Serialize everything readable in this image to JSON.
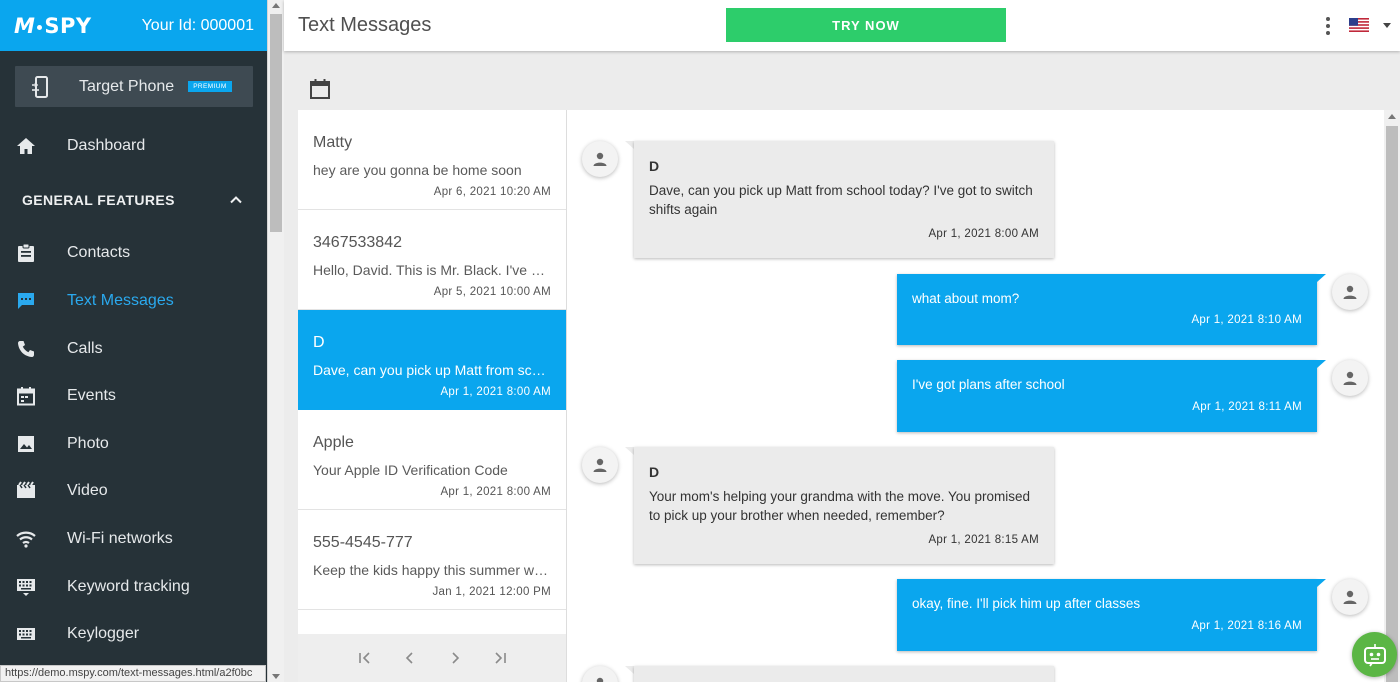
{
  "app": {
    "logo_text": "SPY",
    "logo_m": "M",
    "user_id": "Your Id: 000001"
  },
  "sidebar": {
    "target_phone": {
      "label": "Target Phone",
      "badge": "PREMIUM"
    },
    "dashboard_label": "Dashboard",
    "section_header": "GENERAL FEATURES",
    "items": [
      {
        "label": "Contacts",
        "icon": "clipboard-icon"
      },
      {
        "label": "Text Messages",
        "icon": "message-icon",
        "active": true
      },
      {
        "label": "Calls",
        "icon": "phone-icon"
      },
      {
        "label": "Events",
        "icon": "calendar-icon"
      },
      {
        "label": "Photo",
        "icon": "image-icon"
      },
      {
        "label": "Video",
        "icon": "video-icon"
      },
      {
        "label": "Wi-Fi networks",
        "icon": "wifi-icon"
      },
      {
        "label": "Keyword tracking",
        "icon": "keyboard-icon"
      },
      {
        "label": "Keylogger",
        "icon": "keyboard-icon"
      }
    ]
  },
  "status_bar": {
    "url": "https://demo.mspy.com/text-messages.html/a2f0bc"
  },
  "header": {
    "title": "Text Messages",
    "try_now_label": "TRY NOW"
  },
  "conversations": [
    {
      "name": "Matty",
      "preview": "hey are you gonna be home soon",
      "date": "Apr 6, 2021 10:20 AM",
      "selected": false
    },
    {
      "name": "3467533842",
      "preview": "Hello, David. This is Mr. Black. I've noticed",
      "date": "Apr 5, 2021 10:00 AM",
      "selected": false
    },
    {
      "name": "D",
      "preview": "Dave, can you pick up Matt from school today?",
      "date": "Apr 1, 2021 8:00 AM",
      "selected": true
    },
    {
      "name": "Apple",
      "preview": "Your Apple ID Verification Code",
      "date": "Apr 1, 2021 8:00 AM",
      "selected": false
    },
    {
      "name": "555-4545-777",
      "preview": "Keep the kids happy this summer with our camp",
      "date": "Jan 1, 2021 12:00 PM",
      "selected": false
    }
  ],
  "messages": [
    {
      "direction": "in",
      "sender": "D",
      "text": "Dave, can you pick up Matt from school today? I've got to switch shifts again",
      "time": "Apr 1, 2021 8:00 AM"
    },
    {
      "direction": "out",
      "text": "what about mom?",
      "time": "Apr 1, 2021 8:10 AM"
    },
    {
      "direction": "out",
      "text": "I've got plans after school",
      "time": "Apr 1, 2021 8:11 AM"
    },
    {
      "direction": "in",
      "sender": "D",
      "text": "Your mom's helping your grandma with the move. You promised to pick up your brother when needed, remember?",
      "time": "Apr 1, 2021 8:15 AM"
    },
    {
      "direction": "out",
      "text": "okay, fine. I'll pick him up after classes",
      "time": "Apr 1, 2021 8:16 AM"
    }
  ],
  "colors": {
    "brand_blue": "#0aa6ee",
    "sidebar_bg": "#263238",
    "try_now_green": "#2dcd6b",
    "chatbot_green": "#5bb645"
  }
}
